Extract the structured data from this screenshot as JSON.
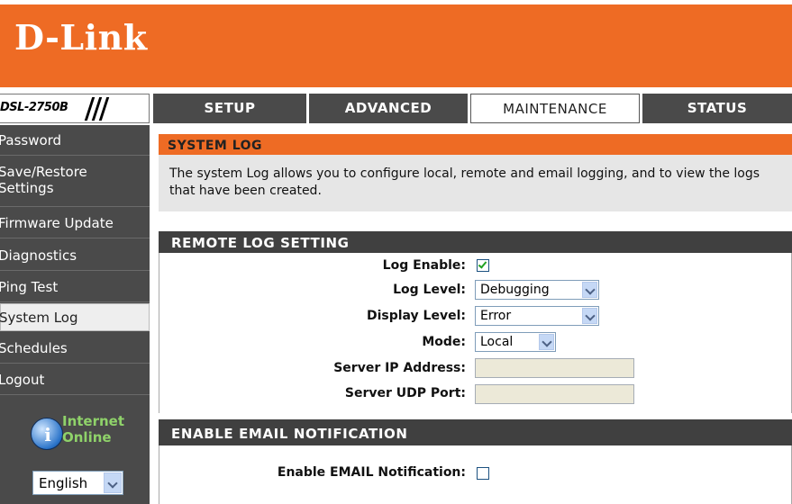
{
  "brand": {
    "logo_text": "D-Link",
    "model": "DSL-2750B",
    "accent_color": "#ee6b24"
  },
  "tabs": [
    {
      "label": "SETUP",
      "active": false
    },
    {
      "label": "ADVANCED",
      "active": false
    },
    {
      "label": "MAINTENANCE",
      "active": true
    },
    {
      "label": "STATUS",
      "active": false
    }
  ],
  "sidebar": {
    "items": [
      {
        "label": "Password",
        "active": false
      },
      {
        "label": "Save/Restore",
        "label2": "Settings",
        "active": false
      },
      {
        "label": "Firmware Update",
        "active": false
      },
      {
        "label": "Diagnostics",
        "active": false
      },
      {
        "label": "Ping Test",
        "active": false
      },
      {
        "label": "System Log",
        "active": true
      },
      {
        "label": "Schedules",
        "active": false
      },
      {
        "label": "Logout",
        "active": false
      }
    ],
    "internet": {
      "line1": "Internet",
      "line2": "Online",
      "icon": "info-globe-icon"
    },
    "language": {
      "selected": "English"
    }
  },
  "main": {
    "section_title": "SYSTEM LOG",
    "intro_text": "The system Log allows you to configure local, remote and email logging, and to view the logs that have been created.",
    "remote": {
      "heading": "REMOTE LOG SETTING",
      "log_enable_label": "Log Enable:",
      "log_enable_checked": true,
      "log_level_label": "Log Level:",
      "log_level_value": "Debugging",
      "display_level_label": "Display Level:",
      "display_level_value": "Error",
      "mode_label": "Mode:",
      "mode_value": "Local",
      "server_ip_label": "Server IP Address:",
      "server_ip_value": "",
      "server_port_label": "Server UDP Port:",
      "server_port_value": ""
    },
    "email": {
      "heading": "ENABLE EMAIL NOTIFICATION",
      "enable_label": "Enable EMAIL Notification:",
      "enable_checked": false
    }
  }
}
